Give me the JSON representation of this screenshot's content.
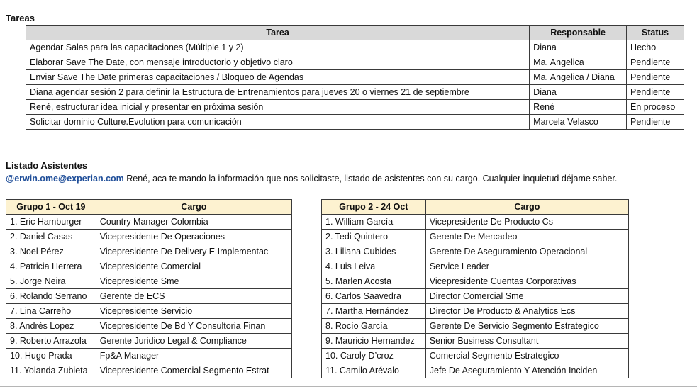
{
  "tareas": {
    "title": "Tareas",
    "headers": [
      "Tarea",
      "Responsable",
      "Status"
    ],
    "rows": [
      [
        "Agendar Salas para las capacitaciones  (Múltiple 1 y 2)",
        "Diana",
        "Hecho"
      ],
      [
        "Elaborar Save The Date, con mensaje introductorio y objetivo claro",
        "Ma. Angelica",
        "Pendiente"
      ],
      [
        "Enviar Save The Date primeras capacitaciones / Bloqueo de Agendas",
        "Ma. Angelica / Diana",
        "Pendiente"
      ],
      [
        "Diana agendar sesión 2 para definir la Estructura de Entrenamientos para jueves 20 o viernes 21 de septiembre",
        "Diana",
        "Pendiente"
      ],
      [
        "René, estructurar idea inicial y presentar en próxima sesión",
        "René",
        "En proceso"
      ],
      [
        "Solicitar dominio Culture.Evolution para comunicación",
        "Marcela Velasco",
        "Pendiente"
      ]
    ]
  },
  "asistentes": {
    "title": "Listado Asistentes",
    "mention": "@erwin.ome@experian.com",
    "message": " René, aca te mando la  información que nos solicitaste, listado de asistentes con su cargo. Cualquier inquietud déjame saber."
  },
  "grupo1": {
    "headers": [
      "Grupo 1  - Oct 19",
      "Cargo"
    ],
    "rows": [
      [
        "1. Eric Hamburger",
        "Country Manager Colombia"
      ],
      [
        "2. Daniel Casas",
        "Vicepresidente De Operaciones"
      ],
      [
        "3. Noel Pérez",
        "Vicepresidente De Delivery E Implementac"
      ],
      [
        "4. Patricia Herrera",
        "Vicepresidente Comercial"
      ],
      [
        "5. Jorge Neira",
        "Vicepresidente Sme"
      ],
      [
        "6. Rolando Serrano",
        "Gerente de ECS"
      ],
      [
        "7. Lina Carreño",
        "Vicepresidente Servicio"
      ],
      [
        "8. Andrés Lopez",
        "Vicepresidente De Bd Y Consultoria Finan"
      ],
      [
        "9. Roberto Arrazola",
        "Gerente Juridico Legal & Compliance"
      ],
      [
        "10. Hugo Prada",
        "Fp&A Manager"
      ],
      [
        "11. Yolanda Zubieta",
        "Vicepresidente Comercial Segmento Estrat"
      ]
    ]
  },
  "grupo2": {
    "headers": [
      "Grupo 2 - 24 Oct",
      "Cargo"
    ],
    "rows": [
      [
        "1. William García",
        "Vicepresidente De Producto Cs"
      ],
      [
        "2. Tedi Quintero",
        "Gerente De Mercadeo"
      ],
      [
        "3. Liliana Cubides",
        "Gerente De Aseguramiento Operacional"
      ],
      [
        "4. Luis Leiva",
        "Service Leader"
      ],
      [
        "5. Marlen Acosta",
        "Vicepresidente Cuentas Corporativas"
      ],
      [
        "6. Carlos Saavedra",
        "Director Comercial Sme"
      ],
      [
        "7. Martha Hernández",
        "Director De Producto & Analytics Ecs"
      ],
      [
        "8. Rocío García",
        "Gerente De Servicio Segmento Estrategico"
      ],
      [
        "9. Mauricio Hernandez",
        "Senior Business Consultant"
      ],
      [
        "10. Caroly D’croz",
        "Comercial Segmento Estrategico"
      ],
      [
        "11. Camilo Arévalo",
        "Jefe De Aseguramiento Y Atención Inciden"
      ]
    ]
  }
}
